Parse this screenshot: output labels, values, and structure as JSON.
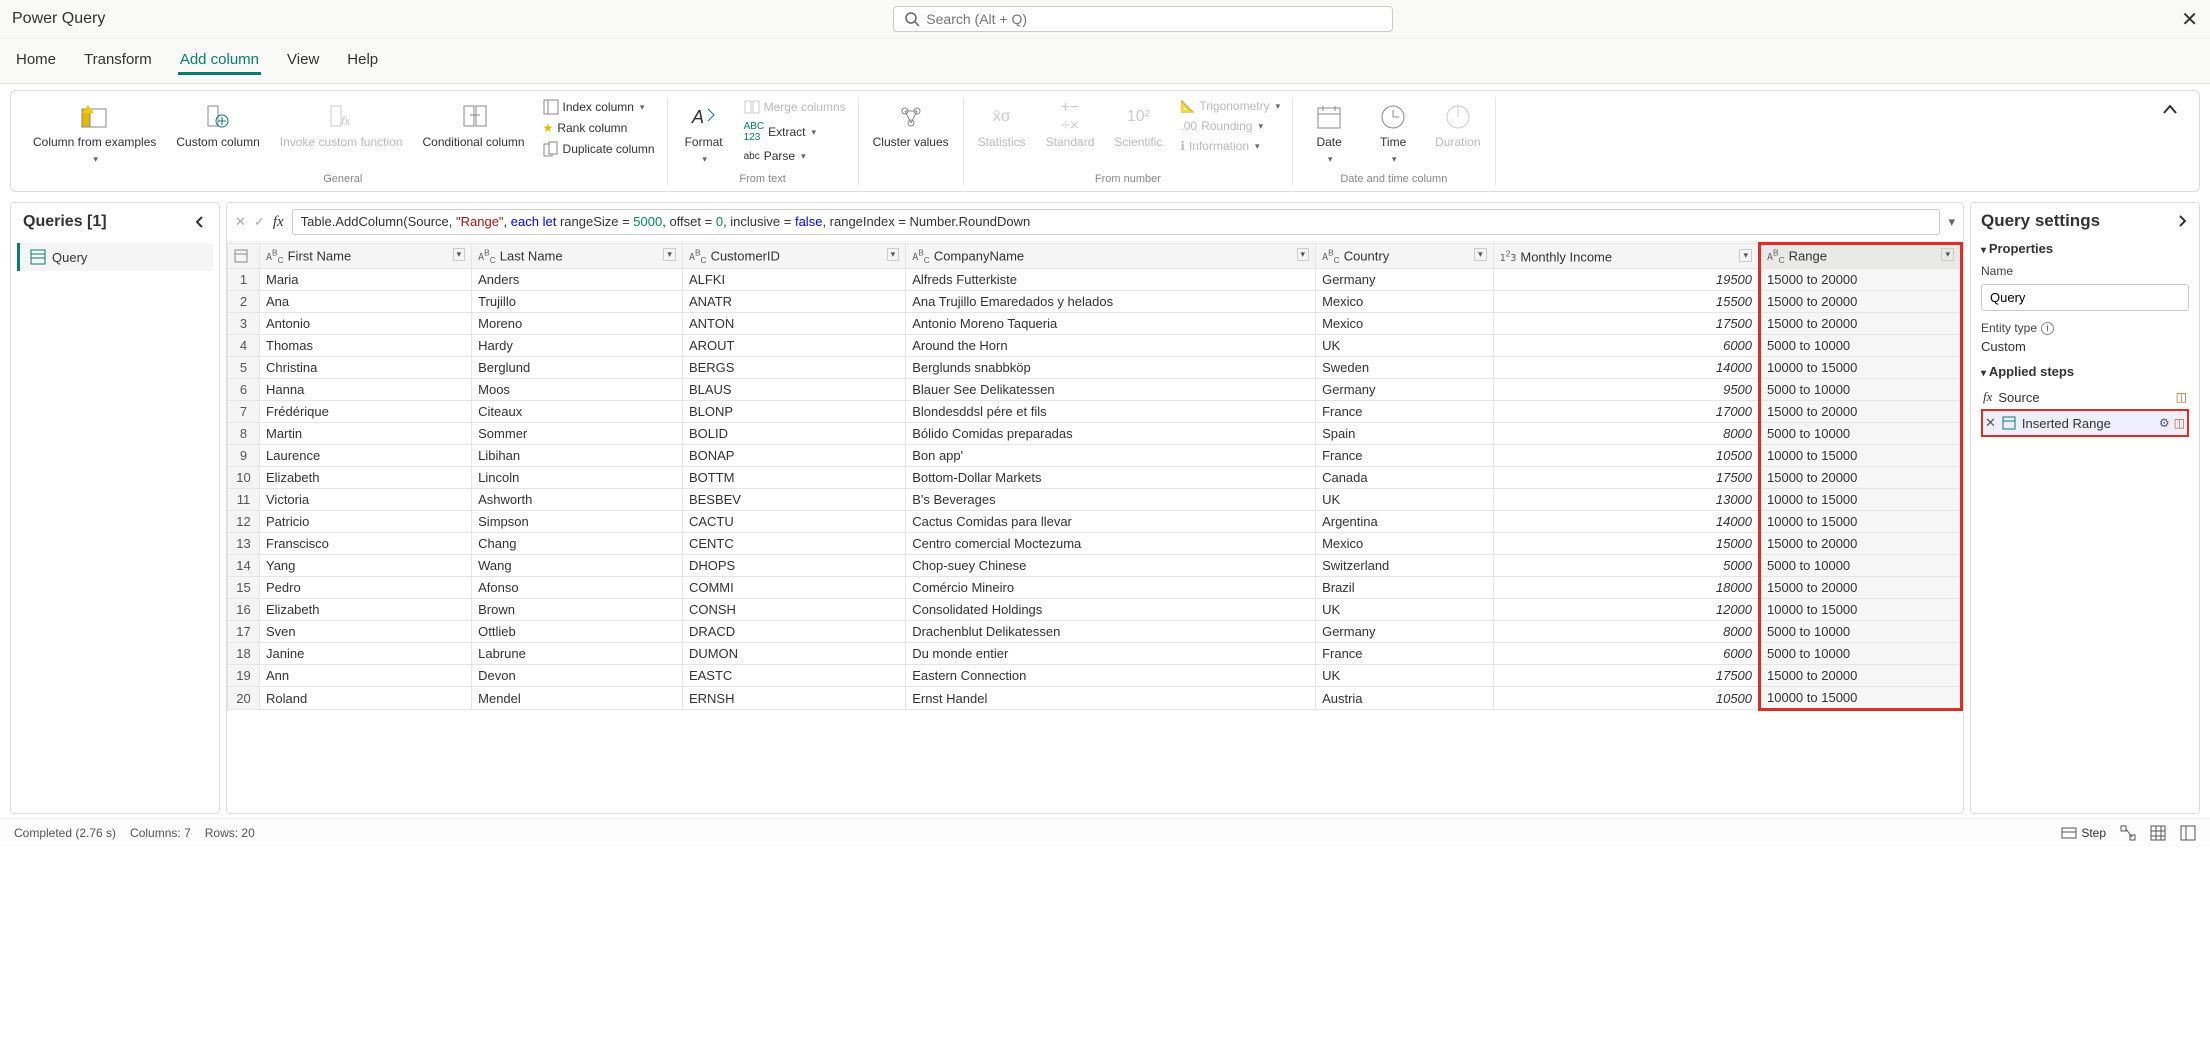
{
  "app": {
    "title": "Power Query",
    "search_placeholder": "Search (Alt + Q)"
  },
  "tabs": [
    {
      "label": "Home"
    },
    {
      "label": "Transform"
    },
    {
      "label": "Add column",
      "active": true
    },
    {
      "label": "View"
    },
    {
      "label": "Help"
    }
  ],
  "ribbon": {
    "general": {
      "col_from_examples": "Column from examples",
      "custom_column": "Custom column",
      "invoke_custom_function": "Invoke custom function",
      "conditional_column": "Conditional column",
      "index_column": "Index column",
      "rank_column": "Rank column",
      "duplicate_column": "Duplicate column",
      "label": "General"
    },
    "from_text": {
      "format": "Format",
      "merge_columns": "Merge columns",
      "extract": "Extract",
      "parse": "Parse",
      "label": "From text"
    },
    "cluster": {
      "cluster_values": "Cluster values"
    },
    "from_number": {
      "statistics": "Statistics",
      "standard": "Standard",
      "scientific": "Scientific",
      "trigonometry": "Trigonometry",
      "rounding": "Rounding",
      "information": "Information",
      "label": "From number"
    },
    "datetime": {
      "date": "Date",
      "time": "Time",
      "duration": "Duration",
      "label": "Date and time column"
    }
  },
  "queries": {
    "title": "Queries [1]",
    "items": [
      "Query"
    ]
  },
  "formula": {
    "parts": [
      {
        "t": "Table.AddColumn(Source, "
      },
      {
        "t": "\"Range\"",
        "cls": "kw-str"
      },
      {
        "t": ", "
      },
      {
        "t": "each let",
        "cls": "kw-kw"
      },
      {
        "t": " rangeSize = "
      },
      {
        "t": "5000",
        "cls": "kw-num"
      },
      {
        "t": ", offset = "
      },
      {
        "t": "0",
        "cls": "kw-num"
      },
      {
        "t": ", inclusive = "
      },
      {
        "t": "false",
        "cls": "kw-kw"
      },
      {
        "t": ", rangeIndex = Number.RoundDown"
      }
    ]
  },
  "table": {
    "columns": [
      {
        "label": "First Name",
        "type": "ABC"
      },
      {
        "label": "Last Name",
        "type": "ABC"
      },
      {
        "label": "CustomerID",
        "type": "ABC"
      },
      {
        "label": "CompanyName",
        "type": "ABC"
      },
      {
        "label": "Country",
        "type": "ABC"
      },
      {
        "label": "Monthly Income",
        "type": "123"
      },
      {
        "label": "Range",
        "type": "ABC",
        "highlight": true
      }
    ],
    "rows": [
      [
        "Maria",
        "Anders",
        "ALFKI",
        "Alfreds Futterkiste",
        "Germany",
        "19500",
        "15000 to 20000"
      ],
      [
        "Ana",
        "Trujillo",
        "ANATR",
        "Ana Trujillo Emaredados y helados",
        "Mexico",
        "15500",
        "15000 to 20000"
      ],
      [
        "Antonio",
        "Moreno",
        "ANTON",
        "Antonio Moreno Taqueria",
        "Mexico",
        "17500",
        "15000 to 20000"
      ],
      [
        "Thomas",
        "Hardy",
        "AROUT",
        "Around the Horn",
        "UK",
        "6000",
        "5000 to 10000"
      ],
      [
        "Christina",
        "Berglund",
        "BERGS",
        "Berglunds snabbköp",
        "Sweden",
        "14000",
        "10000 to 15000"
      ],
      [
        "Hanna",
        "Moos",
        "BLAUS",
        "Blauer See Delikatessen",
        "Germany",
        "9500",
        "5000 to 10000"
      ],
      [
        "Frédérique",
        "Citeaux",
        "BLONP",
        "Blondesddsl pére et fils",
        "France",
        "17000",
        "15000 to 20000"
      ],
      [
        "Martin",
        "Sommer",
        "BOLID",
        "Bólido Comidas preparadas",
        "Spain",
        "8000",
        "5000 to 10000"
      ],
      [
        "Laurence",
        "Libihan",
        "BONAP",
        "Bon app'",
        "France",
        "10500",
        "10000 to 15000"
      ],
      [
        "Elizabeth",
        "Lincoln",
        "BOTTM",
        "Bottom-Dollar Markets",
        "Canada",
        "17500",
        "15000 to 20000"
      ],
      [
        "Victoria",
        "Ashworth",
        "BESBEV",
        "B's Beverages",
        "UK",
        "13000",
        "10000 to 15000"
      ],
      [
        "Patricio",
        "Simpson",
        "CACTU",
        "Cactus Comidas para llevar",
        "Argentina",
        "14000",
        "10000 to 15000"
      ],
      [
        "Franscisco",
        "Chang",
        "CENTC",
        "Centro comercial Moctezuma",
        "Mexico",
        "15000",
        "15000 to 20000"
      ],
      [
        "Yang",
        "Wang",
        "DHOPS",
        "Chop-suey Chinese",
        "Switzerland",
        "5000",
        "5000 to 10000"
      ],
      [
        "Pedro",
        "Afonso",
        "COMMI",
        "Comércio Mineiro",
        "Brazil",
        "18000",
        "15000 to 20000"
      ],
      [
        "Elizabeth",
        "Brown",
        "CONSH",
        "Consolidated Holdings",
        "UK",
        "12000",
        "10000 to 15000"
      ],
      [
        "Sven",
        "Ottlieb",
        "DRACD",
        "Drachenblut Delikatessen",
        "Germany",
        "8000",
        "5000 to 10000"
      ],
      [
        "Janine",
        "Labrune",
        "DUMON",
        "Du monde entier",
        "France",
        "6000",
        "5000 to 10000"
      ],
      [
        "Ann",
        "Devon",
        "EASTC",
        "Eastern Connection",
        "UK",
        "17500",
        "15000 to 20000"
      ],
      [
        "Roland",
        "Mendel",
        "ERNSH",
        "Ernst Handel",
        "Austria",
        "10500",
        "10000 to 15000"
      ]
    ]
  },
  "settings": {
    "title": "Query settings",
    "properties_label": "Properties",
    "name_label": "Name",
    "name_value": "Query",
    "entity_type_label": "Entity type",
    "entity_type_value": "Custom",
    "applied_steps_label": "Applied steps",
    "steps": [
      {
        "label": "Source",
        "icon": "fx"
      },
      {
        "label": "Inserted Range",
        "icon": "table",
        "active": true
      }
    ]
  },
  "statusbar": {
    "completed": "Completed (2.76 s)",
    "columns": "Columns: 7",
    "rows": "Rows: 20",
    "step": "Step"
  }
}
